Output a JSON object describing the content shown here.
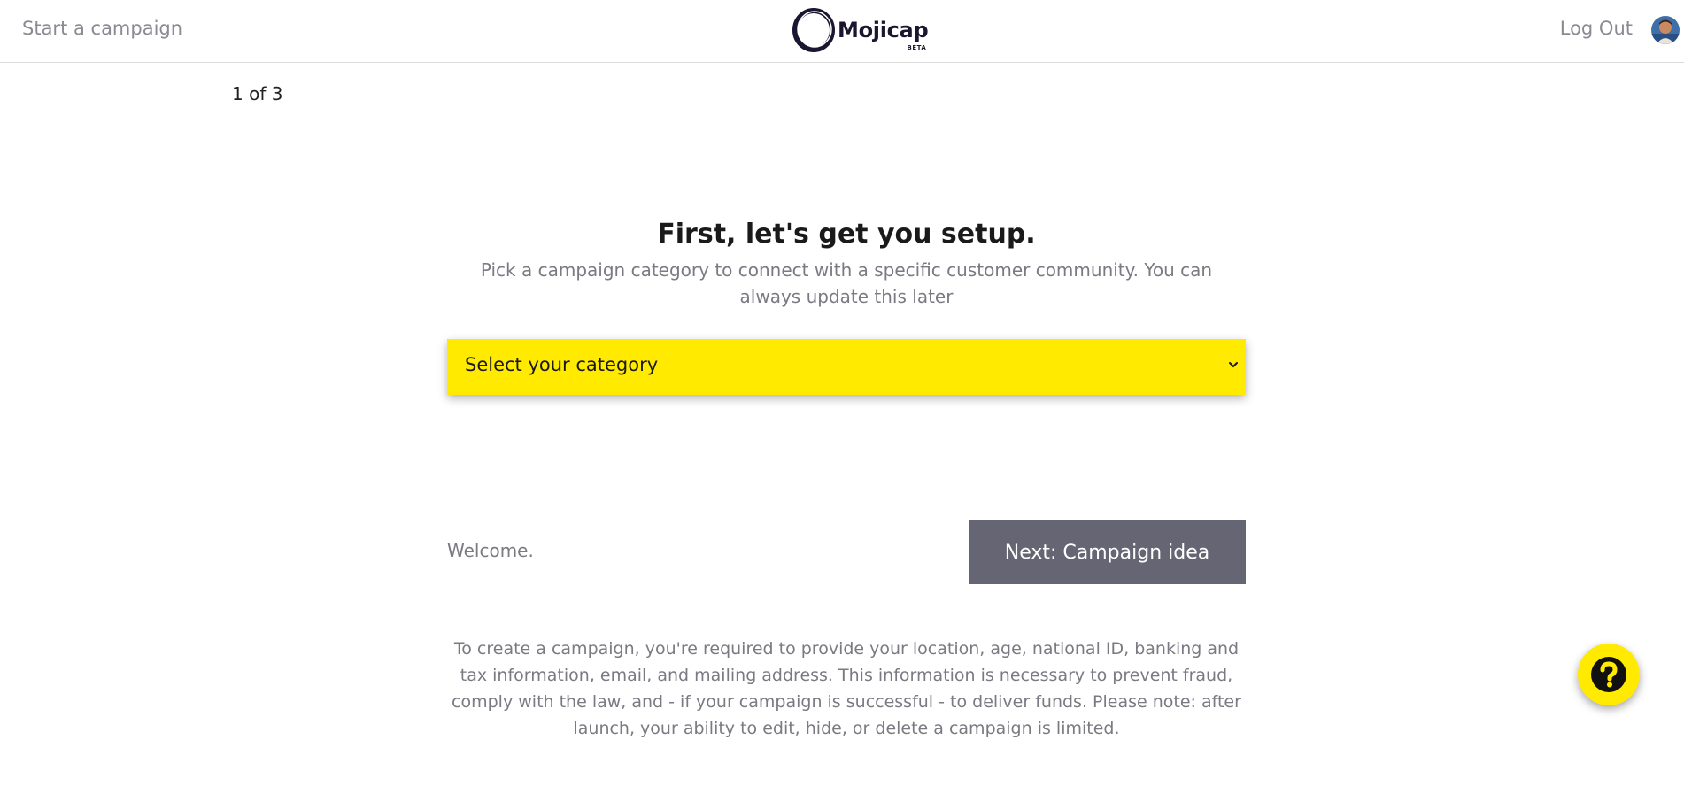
{
  "header": {
    "start_link": "Start a campaign",
    "logo_text": "Mojicap",
    "logo_badge": "BETA",
    "logout_label": "Log Out"
  },
  "progress": {
    "step_text": "1 of 3"
  },
  "main": {
    "title": "First, let's get you setup.",
    "subtitle": "Pick a campaign category to connect with a specific customer community. You can always update this later",
    "category_select": {
      "selected_value": "Select your category",
      "icon": "chevron-down-icon"
    },
    "welcome_text": "Welcome.",
    "next_button_label": "Next: Campaign idea",
    "disclaimer": "To create a campaign, you're required to provide your location, age, national ID, banking and tax information, email, and mailing address. This information is necessary to prevent fraud, comply with the law, and - if your campaign is successful - to deliver funds. Please note: after launch, your ability to edit, hide, or delete a campaign is limited."
  },
  "help": {
    "icon": "question-icon"
  },
  "colors": {
    "accent_yellow": "#ffea00",
    "button_gray": "#666573",
    "muted_text": "#7a7a82",
    "logo_dark": "#1c1530"
  }
}
